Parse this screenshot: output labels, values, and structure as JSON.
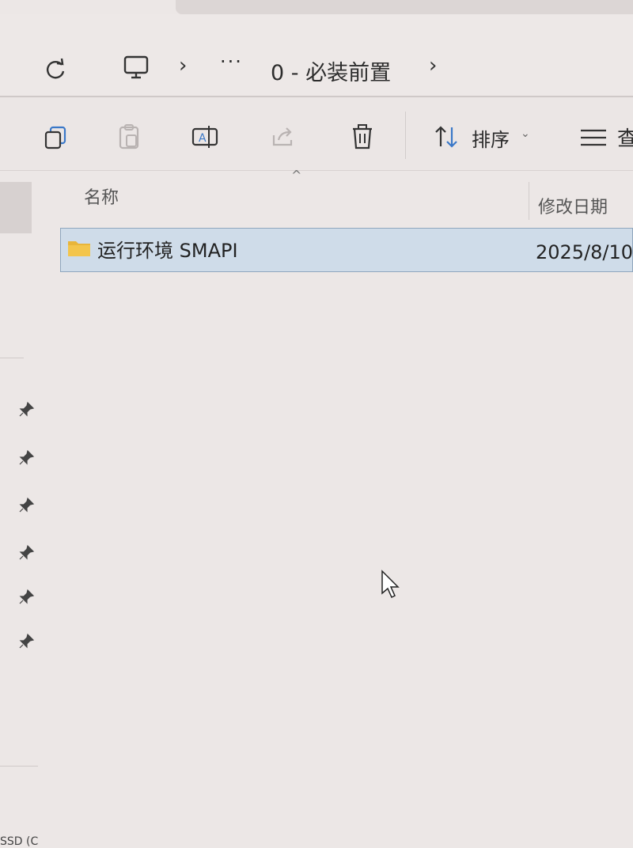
{
  "address": {
    "more": "···",
    "crumb_label": "0 - 必装前置"
  },
  "toolbar": {
    "sort_label": "排序",
    "view_label": "查"
  },
  "columns": {
    "name": "名称",
    "date": "修改日期"
  },
  "files": [
    {
      "name": "运行环境 SMAPI",
      "date": "2025/8/10",
      "selected": true
    }
  ],
  "status_partial": "SSD (C",
  "icons": {
    "refresh": "refresh-icon",
    "computer": "computer-icon",
    "copy": "copy-icon",
    "paste": "paste-icon",
    "rename": "rename-icon",
    "share": "share-icon",
    "delete": "trash-icon",
    "sort": "sort-arrows-icon",
    "view": "view-lines-icon",
    "folder": "folder-icon",
    "pin": "pin-icon"
  },
  "colors": {
    "selection": "#cfdce9",
    "selection_border": "#8fa6bd",
    "folder": "#e8b53a",
    "accent_blue": "#3a78c8"
  }
}
